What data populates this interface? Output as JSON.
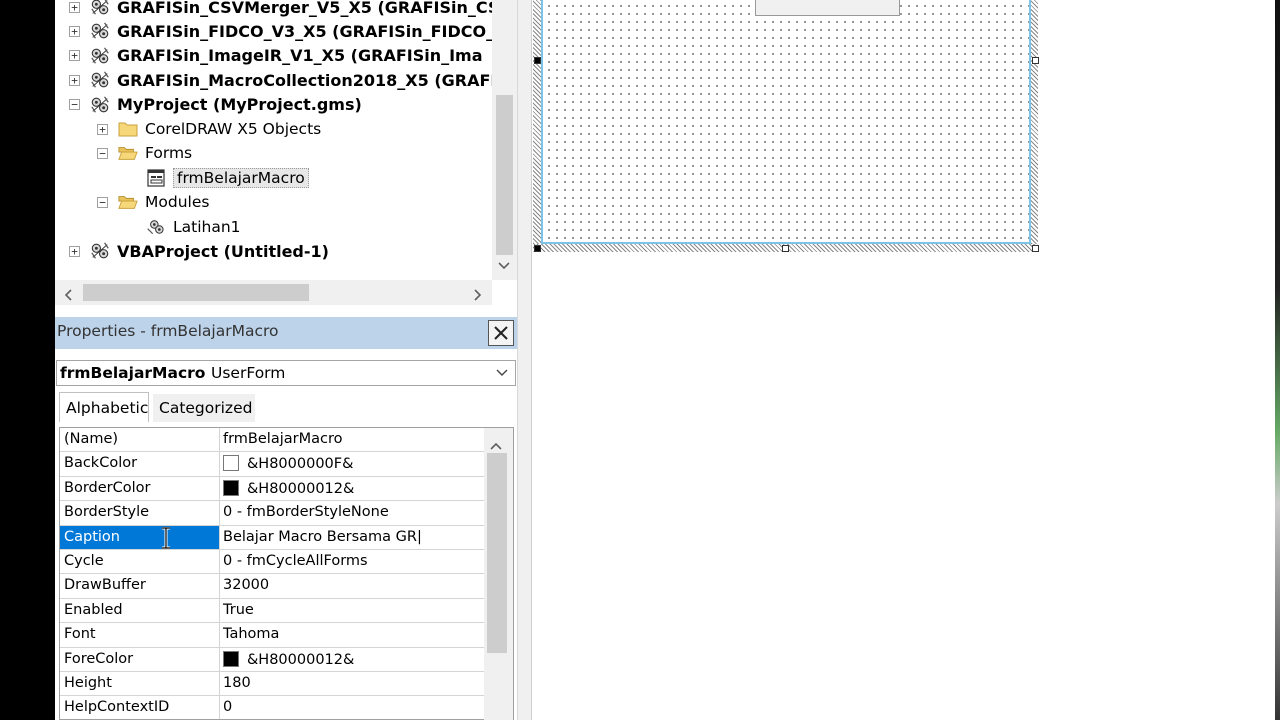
{
  "project_tree": {
    "items": [
      {
        "label": "GRAFISin_CSVMerger_V5_X5 (GRAFISin_CS",
        "level": 0,
        "expander": "+",
        "bold": true,
        "icon": "vba-project-icon"
      },
      {
        "label": "GRAFISin_FIDCO_V3_X5 (GRAFISin_FIDCO_",
        "level": 0,
        "expander": "+",
        "bold": true,
        "icon": "vba-project-icon"
      },
      {
        "label": "GRAFISin_ImageIR_V1_X5 (GRAFISin_Ima",
        "level": 0,
        "expander": "+",
        "bold": true,
        "icon": "vba-project-icon"
      },
      {
        "label": "GRAFISin_MacroCollection2018_X5 (GRAFI",
        "level": 0,
        "expander": "+",
        "bold": true,
        "icon": "vba-project-icon"
      },
      {
        "label": "MyProject (MyProject.gms)",
        "level": 0,
        "expander": "−",
        "bold": true,
        "icon": "vba-project-icon"
      },
      {
        "label": "CorelDRAW X5 Objects",
        "level": 1,
        "expander": "+",
        "bold": false,
        "icon": "folder-icon"
      },
      {
        "label": "Forms",
        "level": 1,
        "expander": "−",
        "bold": false,
        "icon": "folder-open-icon"
      },
      {
        "label": "frmBelajarMacro",
        "level": 2,
        "expander": "",
        "bold": false,
        "icon": "userform-icon",
        "selected": true
      },
      {
        "label": "Modules",
        "level": 1,
        "expander": "−",
        "bold": false,
        "icon": "folder-open-icon"
      },
      {
        "label": "Latihan1",
        "level": 2,
        "expander": "",
        "bold": false,
        "icon": "module-icon"
      },
      {
        "label": "VBAProject (Untitled-1)",
        "level": 0,
        "expander": "+",
        "bold": true,
        "icon": "vba-project-icon"
      }
    ]
  },
  "properties": {
    "title": "Properties - frmBelajarMacro",
    "object_name": "frmBelajarMacro",
    "object_type": "UserForm",
    "tabs": [
      {
        "label": "Alphabetic",
        "active": true
      },
      {
        "label": "Categorized",
        "active": false
      }
    ],
    "rows": [
      {
        "key": "(Name)",
        "value": "frmBelajarMacro"
      },
      {
        "key": "BackColor",
        "value": "&H8000000F&",
        "swatch": "#ffffff"
      },
      {
        "key": "BorderColor",
        "value": "&H80000012&",
        "swatch": "#000000"
      },
      {
        "key": "BorderStyle",
        "value": "0 - fmBorderStyleNone"
      },
      {
        "key": "Caption",
        "value": "Belajar Macro Bersama GR|",
        "selected": true
      },
      {
        "key": "Cycle",
        "value": "0 - fmCycleAllForms"
      },
      {
        "key": "DrawBuffer",
        "value": "32000"
      },
      {
        "key": "Enabled",
        "value": "True"
      },
      {
        "key": "Font",
        "value": "Tahoma"
      },
      {
        "key": "ForeColor",
        "value": "&H80000012&",
        "swatch": "#000000"
      },
      {
        "key": "Height",
        "value": "180"
      },
      {
        "key": "HelpContextID",
        "value": "0"
      }
    ]
  },
  "colors": {
    "selection": "#0078d7",
    "title_bar": "#bdd3ea",
    "form_border": "#7ac4e8"
  }
}
